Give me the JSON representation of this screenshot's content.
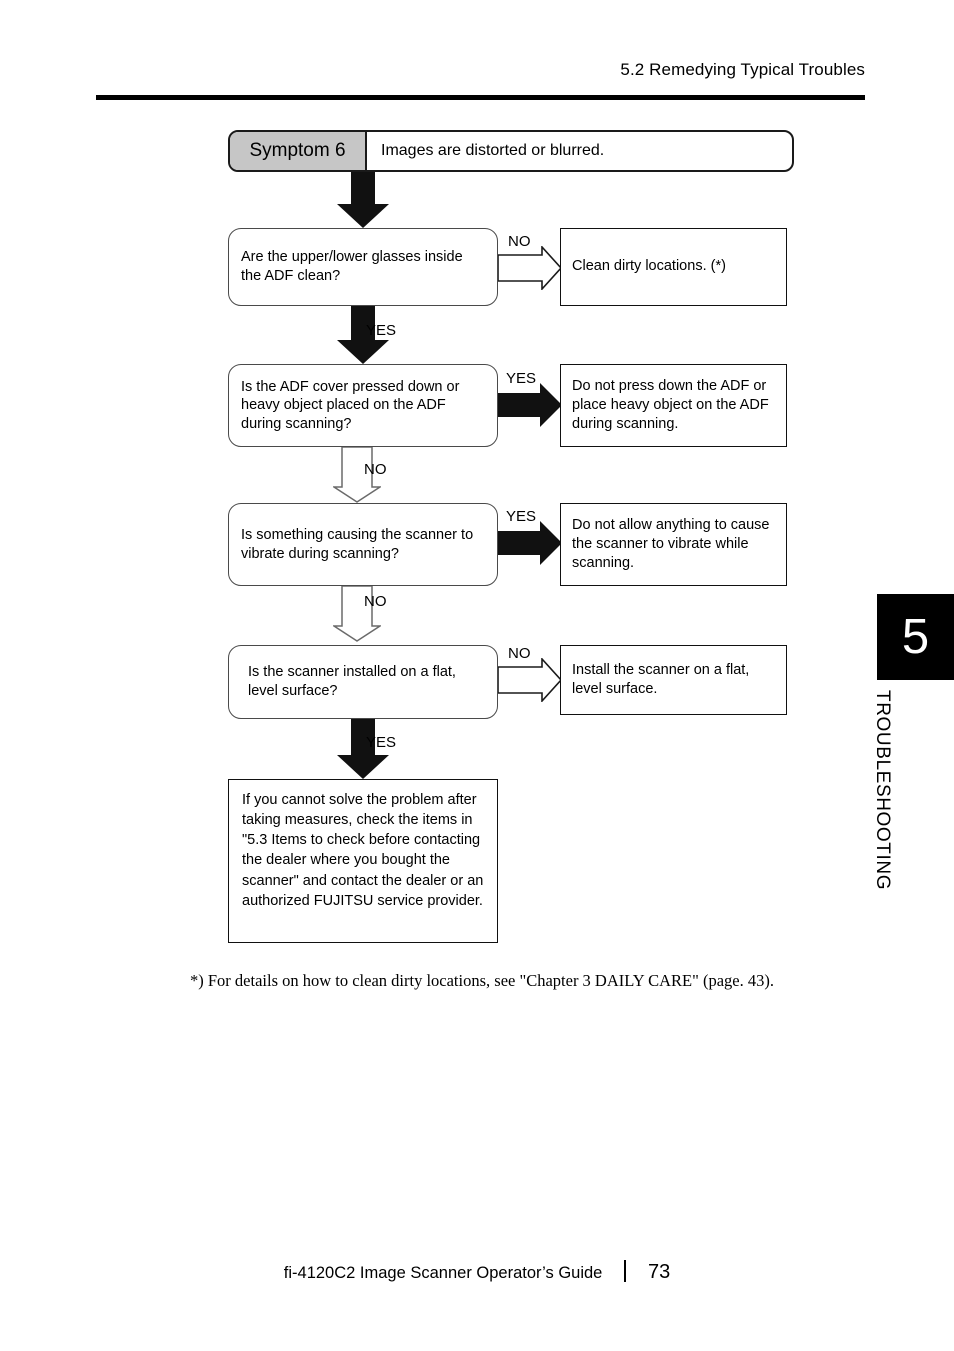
{
  "header": {
    "section_title": "5.2 Remedying Typical Troubles"
  },
  "symptom": {
    "tag": "Symptom 6",
    "description": "Images are distorted or blurred."
  },
  "flow": {
    "decisions": [
      {
        "id": "glasses-clean",
        "text": "Are the upper/lower glasses inside the ADF clean?"
      },
      {
        "id": "adf-cover-pressed",
        "text": "Is the ADF cover pressed down or heavy object placed on the ADF during scanning?"
      },
      {
        "id": "scanner-vibrating",
        "text": "Is something causing the scanner to vibrate during scanning?"
      },
      {
        "id": "flat-level-surface",
        "text": "Is the scanner installed on a flat, level surface?"
      }
    ],
    "actions": [
      {
        "id": "clean-dirty-locations",
        "text": "Clean dirty locations. (*)"
      },
      {
        "id": "do-not-press-adf",
        "text": "Do not press down the ADF or place heavy object on the ADF during scanning."
      },
      {
        "id": "do-not-allow-vibration",
        "text": "Do not allow anything to cause the scanner to vibrate while scanning."
      },
      {
        "id": "install-flat-surface",
        "text": "Install the scanner on a flat, level surface."
      }
    ],
    "branch_labels": {
      "no": "NO",
      "yes": "YES"
    },
    "branches": [
      {
        "from": "glasses-clean",
        "answer": "NO",
        "direction": "right",
        "style": "outline"
      },
      {
        "from": "glasses-clean",
        "answer": "YES",
        "direction": "down",
        "style": "solid"
      },
      {
        "from": "adf-cover-pressed",
        "answer": "YES",
        "direction": "right",
        "style": "solid"
      },
      {
        "from": "adf-cover-pressed",
        "answer": "NO",
        "direction": "down",
        "style": "outline"
      },
      {
        "from": "scanner-vibrating",
        "answer": "YES",
        "direction": "right",
        "style": "solid"
      },
      {
        "from": "scanner-vibrating",
        "answer": "NO",
        "direction": "down",
        "style": "outline"
      },
      {
        "from": "flat-level-surface",
        "answer": "NO",
        "direction": "right",
        "style": "outline"
      },
      {
        "from": "flat-level-surface",
        "answer": "YES",
        "direction": "down",
        "style": "solid"
      }
    ],
    "final_note": "If you cannot solve the problem after taking measures, check the items in \"5.3 Items to check before contacting the dealer where you bought the scanner\" and contact the dealer or an authorized FUJITSU service provider."
  },
  "footnote": "*)  For details on how to clean dirty locations, see \"Chapter 3 DAILY CARE\" (page. 43).",
  "chapter_tab": {
    "number": "5",
    "label": "TROUBLESHOOTING"
  },
  "footer": {
    "document_title": "fi-4120C2 Image Scanner Operator’s Guide",
    "page_number": "73"
  },
  "colors": {
    "symptom_tag_fill": "#c6c6c6",
    "rule": "#000000",
    "shadow": "#111111",
    "decision_border": "#4a4a4a"
  }
}
